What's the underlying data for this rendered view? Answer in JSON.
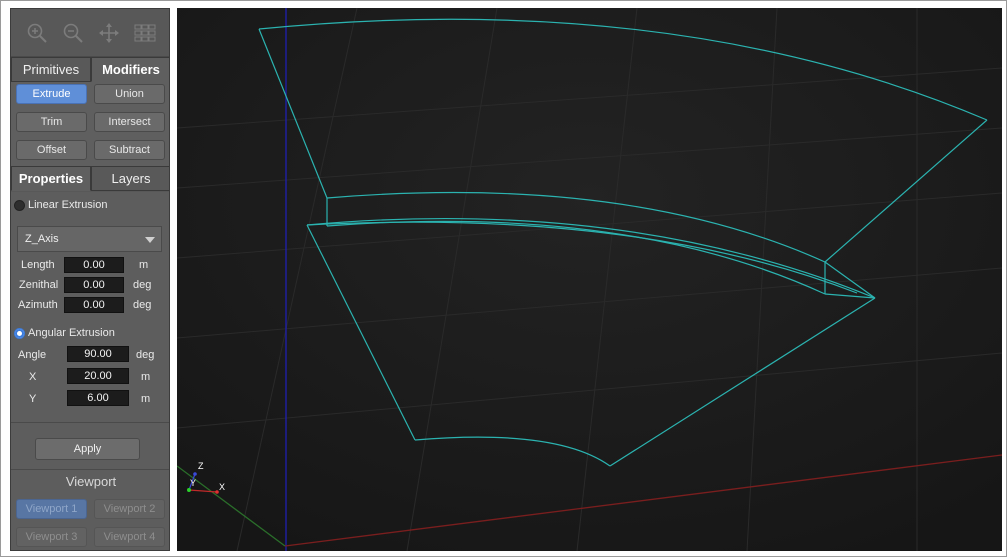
{
  "toolbar": {
    "icons": [
      "zoom-in-icon",
      "zoom-out-icon",
      "pan-icon",
      "grid-icon"
    ]
  },
  "tabs_top": [
    {
      "label": "Primitives",
      "active": false
    },
    {
      "label": "Modifiers",
      "active": true
    }
  ],
  "modifiers": {
    "extrude": "Extrude",
    "union": "Union",
    "trim": "Trim",
    "intersect": "Intersect",
    "offset": "Offset",
    "subtract": "Subtract"
  },
  "tabs_mid": [
    {
      "label": "Properties",
      "active": true
    },
    {
      "label": "Layers",
      "active": false
    }
  ],
  "linear": {
    "label": "Linear Extrusion",
    "selected": false,
    "axis": "Z_Axis",
    "length_label": "Length",
    "length": "0.00",
    "length_unit": "m",
    "zenithal_label": "Zenithal",
    "zenithal": "0.00",
    "zenithal_unit": "deg",
    "azimuth_label": "Azimuth",
    "azimuth": "0.00",
    "azimuth_unit": "deg"
  },
  "angular": {
    "label": "Angular Extrusion",
    "selected": true,
    "angle_label": "Angle",
    "angle": "90.00",
    "angle_unit": "deg",
    "x_label": "X",
    "x": "20.00",
    "x_unit": "m",
    "y_label": "Y",
    "y": "6.00",
    "y_unit": "m"
  },
  "apply_label": "Apply",
  "viewport_panel": {
    "title": "Viewport",
    "buttons": [
      "Viewport 1",
      "Viewport 2",
      "Viewport 3",
      "Viewport 4"
    ],
    "active_index": 0
  },
  "gizmo": {
    "z_label": "Z",
    "y_label": "Y",
    "x_label": "X"
  },
  "colors": {
    "accent": "#5f8fd8",
    "wireframe": "#2bb3b0",
    "x_axis": "#8a2020",
    "y_axis": "#2a7a2a",
    "z_axis": "#1f1fb0",
    "viewport_bg": "#1a1a1a"
  }
}
